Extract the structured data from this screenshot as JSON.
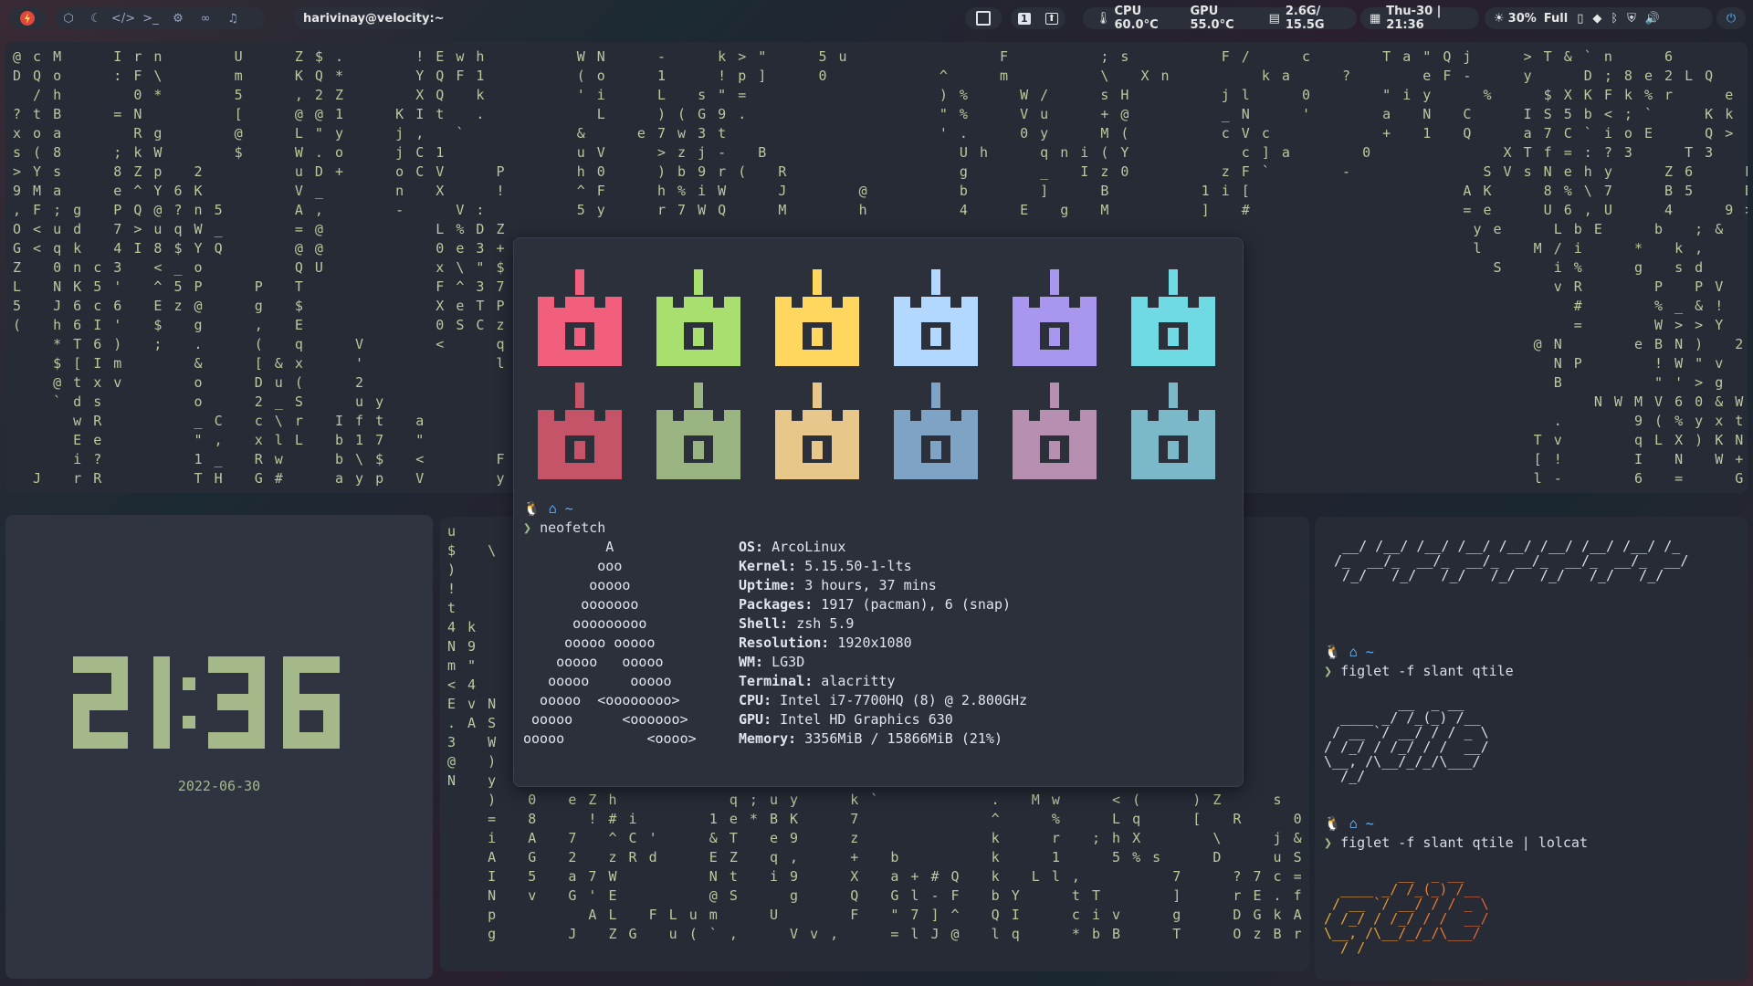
{
  "topbar": {
    "user_tag": "harivinay@velocity:~",
    "cpu": "CPU 60.0°C",
    "gpu": "GPU 55.0°C",
    "mem": "2.6G/ 15.5G",
    "datetime": "Thu-30 | 21:36",
    "brightness": "30%",
    "battery": "Full",
    "workspace_num": "1",
    "icons": [
      "app-logo-icon",
      "grid-icon",
      "moon-icon",
      "code-icon",
      "terminal-icon",
      "gear-icon",
      "link-icon",
      "music-icon"
    ]
  },
  "clock": {
    "time": "21:36",
    "date": "2022-06-30"
  },
  "neofetch": {
    "prompt_dir": "~",
    "command": "neofetch",
    "info": [
      {
        "k": "OS:",
        "v": "ArcoLinux"
      },
      {
        "k": "Kernel:",
        "v": "5.15.50-1-lts"
      },
      {
        "k": "Uptime:",
        "v": "3 hours, 37 mins"
      },
      {
        "k": "Packages:",
        "v": "1917 (pacman), 6 (snap)"
      },
      {
        "k": "Shell:",
        "v": "zsh 5.9"
      },
      {
        "k": "Resolution:",
        "v": "1920x1080"
      },
      {
        "k": "WM:",
        "v": "LG3D"
      },
      {
        "k": "Terminal:",
        "v": "alacritty"
      },
      {
        "k": "CPU:",
        "v": "Intel i7-7700HQ (8) @ 2.800GHz"
      },
      {
        "k": "GPU:",
        "v": "Intel HD Graphics 630"
      },
      {
        "k": "Memory:",
        "v": "3356MiB / 15866MiB (21%)"
      }
    ],
    "logo": "          A\n         ooo\n        ooooo\n       ooooooo\n      ooooooooo\n     ooooo ooooo\n    ooooo   ooooo\n   ooooo     ooooo\n  ooooo  <oooooooo>\n ooooo      <oooooo>\nooooo          <oooo>",
    "palette_top": [
      "#f25f7c",
      "#a8df6e",
      "#ffd75f",
      "#b3d8ff",
      "#a996ef",
      "#6fd9e4"
    ],
    "palette_bottom": [
      "#c65468",
      "#9ab581",
      "#e8c88a",
      "#7fa3c4",
      "#b78fb0",
      "#7bb8c8"
    ]
  },
  "figlet": {
    "header_art": "  __/ /__/ /__/ /__/ /__/ /__/ /__/ /__/ /_\n /_  __/_  __/_  __/_  __/_  __/_  __/_  __/\n  /_/   /_/   /_/   /_/   /_/   /_/   /_/",
    "cmd1": "figlet -f slant qtile",
    "cmd2": "figlet -f slant qtile | lolcat",
    "art": "         __  _ __\n  ____ _/ /_(_) /__\n / __ `/ __/ / / _ \\\n/ /_/ / /_/ / /  __/\n\\__, /\\__/_/_/\\___/\n  /_/",
    "prompt_dir": "~"
  },
  "matrix": {
    "top": "@ c M     I r n       U     Z $ .       ! E w h         W N     -     k > \"     5 u               F         ; s         F /     c       T a \" Q j     > T & ` n     6             h     G o O k         ]     g V # w y\nD Q o     : F \\       m     K Q *       Y Q F 1         ( o     1     ! p ]     0           ^     m         \\   X n         k a     ?       e F -     y     D ; 8 e 2 L Q                 J , - /           m     / f D * %\n  / h       0 *       5     , 2 Z       X Q   k         ' i     L   s \" =                   ) %     W /     s H         j l     0       \" i y     %     $ X K F k % r     e           P ( q )           P     S u     b N\n? t B     = N         [     @ @ 1     K I t   .           L     ) ( G 9 .                   \" %     V u     + @         _ N     '       a   N   C     I S 5 b < ; `     K k     c C   , - V                   n u     , ?\nx o a       R g       @     L \" y     j ,   `           &     e 7 w 3 t                     ' .     0 y     M (         c V c           +   1   Q     a 7 C ` i o E     Q >     0 g   8 = .           ;     8 % s\ns ( 8     ; k W       $     W . o     j C 1             u V     > z j -   B                   U h     q n i ( Y           c ] a       0             X T f = : ? 3     T 3     9 )   2 , R       F G       W j     w o\n> Y s     8 Z p   2         u D +     o C V     P       h 0     ) b 9 r (   R                 g       _   I z 0         z F `       -             S V s N e h y     Z 6     P     X % <       a >         f     : &\n9 M a     e ^ Y 6 K         V _       n   X     !       ^ F     h % i W     J       @         b       ]     B         1 i [                     A K     8 % \\ 7     B 5     D     2 U [       S r     7         g     b P\n, F ; g   P Q @ ? n 5       A ,       -     V :         5 y     r 7 W Q     M       h         4     E   g   M         ]   #                     = e     U 6 , U     4     9 >   I = H       8 4     R     D     c 8\nO < u d   7 > u q W _       = @           L % D Z                                                                                                y e     L b E     b   ; &       =         f 9     f     >     y G\nG < q k   4 I 8 $ Y Q       @ @           0 e 3 +                                                                                                l     M / i     *   k ,       /         9 9     H             4 S\nZ   0 n c 3   < _ o         Q U           x \\ \" $ #                                                                                                S     i %     g   s d       I       6 ;   .     4     &     4 S\nL   N K 5 '   ^ 5 P     P   T             F ^ 3 7 J                                                                                                      v R       P   P V       N       ] H 7           u     A\n5   J 6 c 6   E z @     g   $             X e T P 1                                                                                                        #       % _ & !   o     (         : U P           l     $\n(   h 6 I '   $   g     ,   E             0 S C z c                                                                                                        =       W > > Y   r               g 3 6           B     t\n    * T 6 )   ;   .     (   q     V       <     q                                                                                                      @ N       e B N )   2               = J q z         z\n    $ [ I m       &     [ & x     '             l     K M                                                                                                N P       ! W \" v   \\                 . +   S         \" x\n    @ t x v       o     D u (     2                   ? '                                                                                                B         \" ' > g   ? E 1         8 _     4 v       Q ,\n    ` d s         o     2 _ S     u y                 ? ?                                                                                                    N W M V 6 0 & W         f T     K `       F M\n      w R         _ C   c \\ r   I f t   a             M K                                                                                                .       9 ( % y x t R V         ; Q     # N       : k\n      E e         \" ,   x l L   b 1 7   \"             ^ 3                                                                                              T v       q L X ) K N V 9       1 `     b H       f *\n      i ?         1 _   R w     b \\ $   <       F     * @                                                                                              [ !       I   N   W + T         r T     \" s       2 $\n  J   r R         T H   G #     a y p   V       y     * X                                                                                              l -       6   =     G 0   *             G 9       f v",
    "middle": "u\n$   \\\n)\n!\nt       ?\n4 k     W\nN 9     Z\nm \"     ^\n< 4\nE v N\n. A S\n3   W\n@   )\nN   y\n    )   0   e Z h           q ; u y     k `           .   M w     < (     ) Z     s     u x       \" Y         * W\n    =   8     ! # i       1 e * B K     7             ^     %     L q     [   R     0     w     E :     I e     $ i F O\n    i   A   7   ^ C '     & T   e 9     z             k     r   ; h X       \\     j & ^ H     N 5     V H c I\n    A   G   2   z R d     E Z   q ,     +   b         k     1     5 % s     D     u S A Y     e \\     E A \\ N\n    I   5   a 7 W         N t   i 9     X   a + # Q   k   L l ,         7     ? 7 c =             Y + 9 U @\n    N   v   G ' E         @ S     g     Q   G l - F   b Y     t T       ]     r E . f             3 C + ' v\n    p         A L   F L u m     U       F   \" 7 ] ^   Q I     c i v     g     D G k A             $ B * P N\n    g       J   Z G   u ( ` ,     V v ,     = l J @   l q     * b B     T     O z B r             ' h m o ="
  }
}
